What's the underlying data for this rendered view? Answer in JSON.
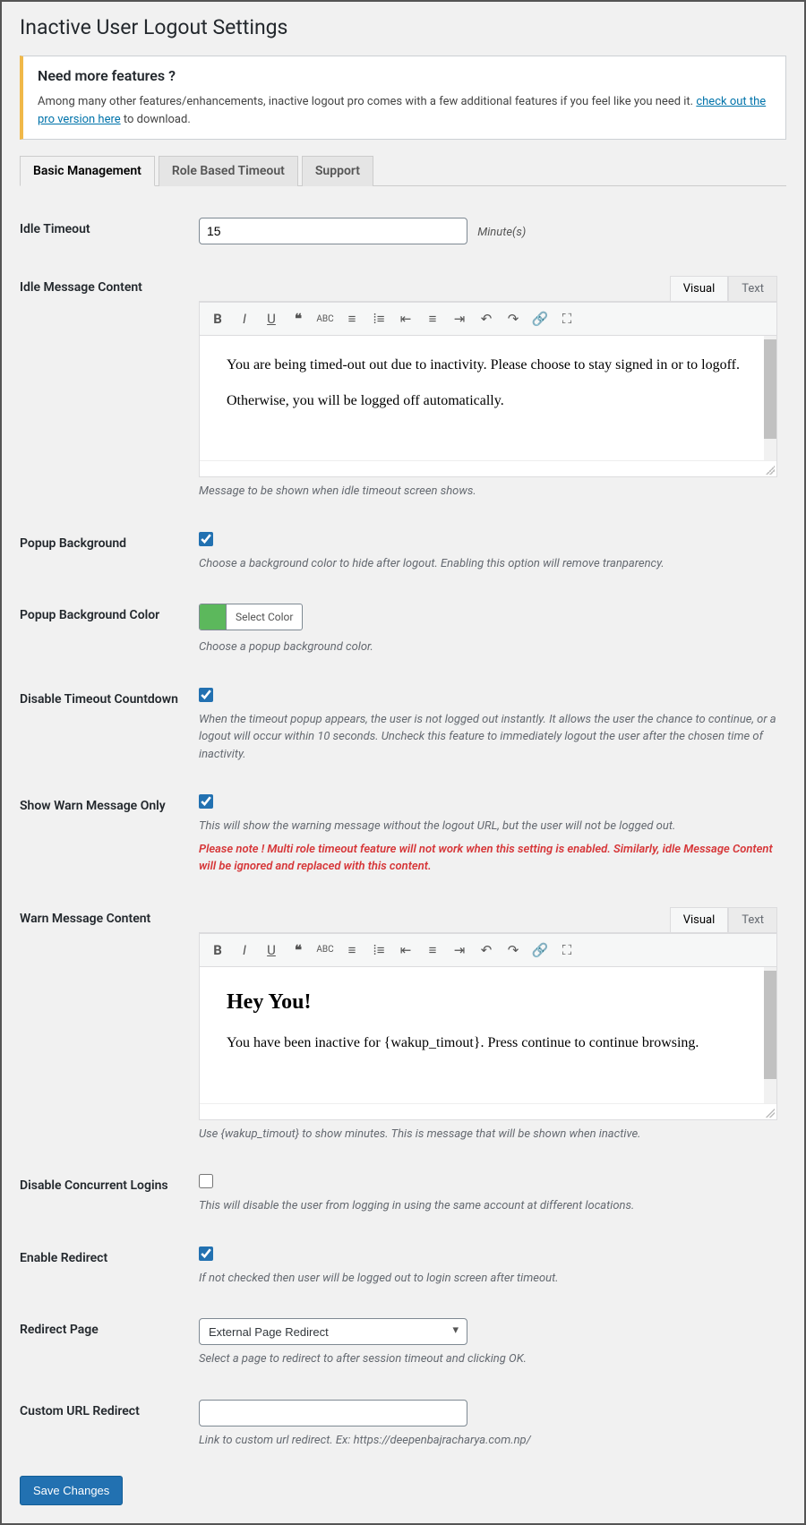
{
  "page_title": "Inactive User Logout Settings",
  "notice": {
    "heading": "Need more features ?",
    "text_before": "Among many other features/enhancements, inactive logout pro comes with a few additional features if you feel like you need it. ",
    "link": "check out the pro version here",
    "text_after": " to download."
  },
  "tabs": [
    {
      "label": "Basic Management",
      "active": true
    },
    {
      "label": "Role Based Timeout",
      "active": false
    },
    {
      "label": "Support",
      "active": false
    }
  ],
  "editor_tabs": {
    "visual": "Visual",
    "text": "Text"
  },
  "fields": {
    "idle_timeout": {
      "label": "Idle Timeout",
      "value": "15",
      "unit": "Minute(s)"
    },
    "idle_message": {
      "label": "Idle Message Content",
      "content_p1": "You are being timed-out out due to inactivity. Please choose to stay signed in or to logoff.",
      "content_p2": "Otherwise, you will be logged off automatically.",
      "desc": "Message to be shown when idle timeout screen shows."
    },
    "popup_bg": {
      "label": "Popup Background",
      "checked": true,
      "desc": "Choose a background color to hide after logout. Enabling this option will remove tranparency."
    },
    "popup_bg_color": {
      "label": "Popup Background Color",
      "button": "Select Color",
      "color": "#5cb85c",
      "desc": "Choose a popup background color."
    },
    "disable_countdown": {
      "label": "Disable Timeout Countdown",
      "checked": true,
      "desc": "When the timeout popup appears, the user is not logged out instantly. It allows the user the chance to continue, or a logout will occur within 10 seconds. Uncheck this feature to immediately logout the user after the chosen time of inactivity."
    },
    "show_warn": {
      "label": "Show Warn Message Only",
      "checked": true,
      "desc": "This will show the warning message without the logout URL, but the user will not be logged out.",
      "red": "Please note ! Multi role timeout feature will not work when this setting is enabled. Similarly, idle Message Content will be ignored and replaced with this content."
    },
    "warn_message": {
      "label": "Warn Message Content",
      "heading": "Hey You!",
      "content": "You have been inactive for {wakup_timout}. Press continue to continue browsing.",
      "desc": "Use {wakup_timout} to show minutes. This is message that will be shown when inactive."
    },
    "disable_concurrent": {
      "label": "Disable Concurrent Logins",
      "checked": false,
      "desc": "This will disable the user from logging in using the same account at different locations."
    },
    "enable_redirect": {
      "label": "Enable Redirect",
      "checked": true,
      "desc": "If not checked then user will be logged out to login screen after timeout."
    },
    "redirect_page": {
      "label": "Redirect Page",
      "selected": "External Page Redirect",
      "desc": "Select a page to redirect to after session timeout and clicking OK."
    },
    "custom_url": {
      "label": "Custom URL Redirect",
      "value": "",
      "desc": "Link to custom url redirect. Ex: https://deepenbajracharya.com.np/"
    }
  },
  "submit_label": "Save Changes"
}
